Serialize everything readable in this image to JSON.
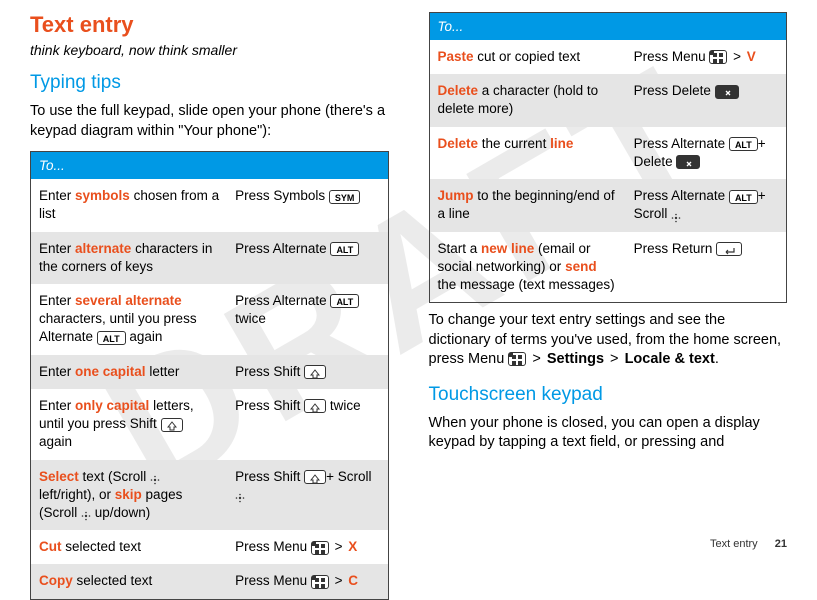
{
  "watermark": "DRAFT",
  "h1": "Text entry",
  "subtitle": "think keyboard, now think smaller",
  "typing_tips_heading": "Typing tips",
  "typing_tips_para": "To use the full keypad, slide open your phone (there's a keypad diagram within \"Your phone\"):",
  "table_header": "To...",
  "left_rows": [
    {
      "l1": "Enter ",
      "hl1": "symbols",
      "l2": " chosen from a list",
      "r1": "Press Symbols ",
      "key": "SYM"
    },
    {
      "l1": "Enter ",
      "hl1": "alternate",
      "l2": " characters in the corners of keys",
      "r1": "Press Alternate ",
      "key": "ALT"
    },
    {
      "l1": "Enter ",
      "hl1": "several alternate",
      "l2": " characters, until you press Alternate ",
      "midkey": "ALT",
      "l3": " again",
      "r1": "Press Alternate ",
      "key": "ALT",
      "r2": " twice"
    },
    {
      "l1": "Enter ",
      "hl1": "one capital",
      "l2": " letter",
      "r1": "Press Shift ",
      "key": "SHIFT"
    },
    {
      "l1": "Enter ",
      "hl1": "only capital",
      "l2": " letters, until you press Shift ",
      "midkey": "SHIFT",
      "l3": " again",
      "r1": "Press Shift ",
      "key": "SHIFT",
      "r2": " twice"
    },
    {
      "hl_first": "Select",
      "l2": " text (Scroll ",
      "sc1": true,
      "l3": " left/right), or ",
      "hl2": "skip",
      "l4": " pages (Scroll ",
      "sc2": true,
      "l5": " up/down)",
      "r1": "Press Shift ",
      "key": "SHIFT",
      "r2": "+ Scroll ",
      "rsc": true
    },
    {
      "hl_first": "Cut",
      "l2": " selected text",
      "r1": "Press Menu ",
      "menu": true,
      "gt": " > ",
      "rx": "X"
    },
    {
      "hl_first": "Copy",
      "l2": " selected text",
      "r1": "Press Menu ",
      "menu": true,
      "gt": " > ",
      "rx": "C"
    }
  ],
  "right_rows": [
    {
      "hl_first": "Paste",
      "l2": " cut or copied text",
      "r1": "Press Menu ",
      "menu": true,
      "gt": " > ",
      "rx": "V"
    },
    {
      "hl_first": "Delete",
      "l2": " a character (hold to delete more)",
      "r1": "Press Delete ",
      "key": "DEL"
    },
    {
      "hl_first": "Delete",
      "l2": " the current ",
      "hl2": "line",
      "r1": "Press Alternate ",
      "key": "ALT",
      "r2": "+ Delete ",
      "key2": "DEL"
    },
    {
      "hl_first": "Jump",
      "l2": " to the beginning/end of a line",
      "r1": "Press Alternate ",
      "key": "ALT",
      "r2": "+ Scroll ",
      "rsc": true
    },
    {
      "l1": "Start a ",
      "hl1": "new line",
      "l2": " (email or social networking) or ",
      "hl2": "send",
      "l4": " the message (text messages)",
      "r1": "Press Return ",
      "key": "RET"
    }
  ],
  "change_para_1": "To change your text entry settings and see the dictionary of terms you've used, from the home screen, press Menu ",
  "change_para_gt1": " > ",
  "change_para_settings": "Settings",
  "change_para_gt2": " > ",
  "change_para_locale": "Locale & text",
  "change_para_dot": ".",
  "touchscreen_heading": "Touchscreen keypad",
  "touchscreen_para": "When your phone is closed, you can open a display keypad by tapping a text field, or pressing and",
  "footer_label": "Text entry",
  "footer_page": "21"
}
